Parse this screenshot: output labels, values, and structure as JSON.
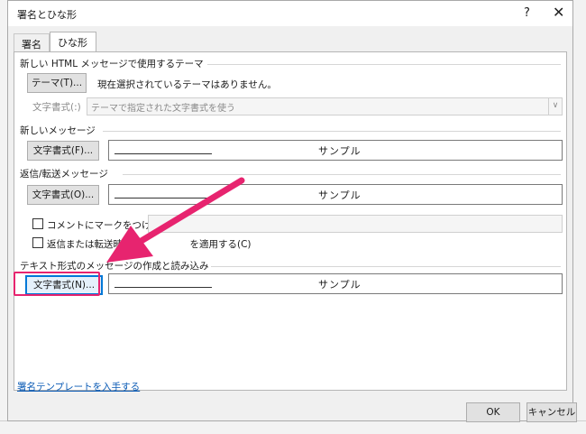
{
  "dialog": {
    "title": "署名とひな形",
    "help": "?",
    "close": "✕"
  },
  "tabs": [
    {
      "label": "署名"
    },
    {
      "label": "ひな形"
    }
  ],
  "theme_section": {
    "label": "新しい HTML メッセージで使用するテーマ",
    "theme_button": "テーマ(T)...",
    "current_theme": "現在選択されているテーマはありません。",
    "font_label": "文字書式(:)",
    "font_select_value": "テーマで指定された文字書式を使う"
  },
  "new_message": {
    "label": "新しいメッセージ",
    "font_button": "文字書式(F)...",
    "sample": "サンプル"
  },
  "reply_forward": {
    "label": "返信/転送メッセージ",
    "font_button": "文字書式(O)...",
    "sample": "サンプル",
    "mark_comments": "コメントにマークをつける(M):",
    "reply_color_prefix": "返信または転送時に",
    "reply_color_suffix": "を適用する(C)"
  },
  "plain_text": {
    "label": "テキスト形式のメッセージの作成と読み込み",
    "font_button": "文字書式(N)...",
    "sample": "サンプル"
  },
  "link": "署名テンプレートを入手する",
  "footer": {
    "ok": "OK",
    "cancel": "キャンセル"
  },
  "colors": {
    "highlight": "#e7246f",
    "focus": "#0078d7",
    "link": "#0b5bb5"
  }
}
